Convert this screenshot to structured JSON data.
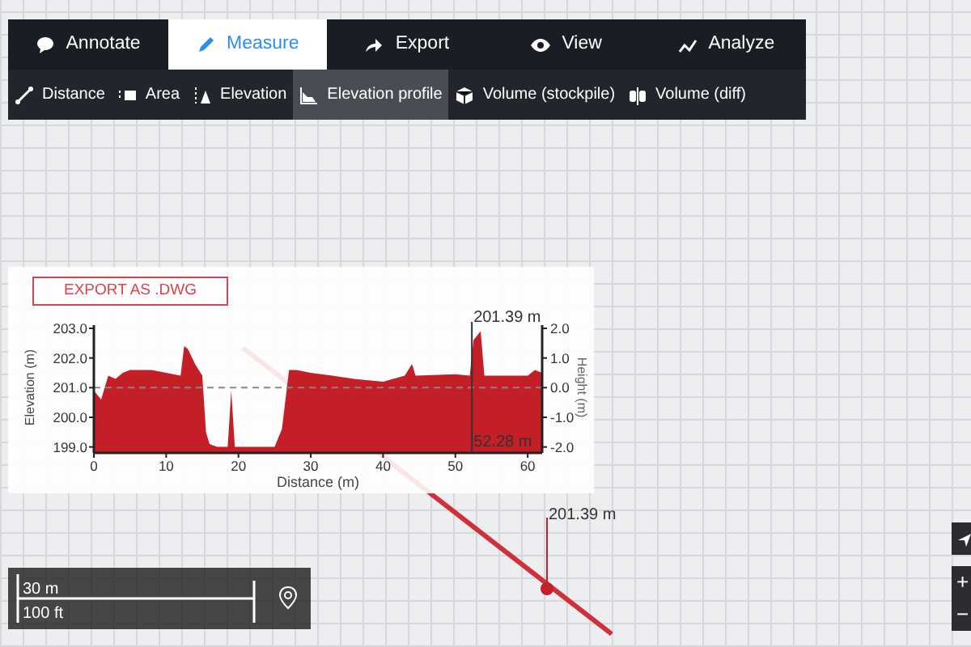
{
  "toolbar": {
    "tabs": [
      {
        "label": "Annotate",
        "selected": false
      },
      {
        "label": "Measure",
        "selected": true
      },
      {
        "label": "Export",
        "selected": false
      },
      {
        "label": "View",
        "selected": false
      },
      {
        "label": "Analyze",
        "selected": false
      }
    ],
    "tools": [
      {
        "label": "Distance",
        "selected": false
      },
      {
        "label": "Area",
        "selected": false
      },
      {
        "label": "Elevation",
        "selected": false
      },
      {
        "label": "Elevation profile",
        "selected": true
      },
      {
        "label": "Volume (stockpile)",
        "selected": false
      },
      {
        "label": "Volume (diff)",
        "selected": false
      }
    ]
  },
  "profile_panel": {
    "export_button": "EXPORT AS .DWG",
    "chart_data": {
      "type": "area",
      "xlabel": "Distance (m)",
      "ylabel": "Elevation (m)",
      "x": [
        0,
        1,
        2,
        3,
        4,
        5,
        8,
        10,
        12,
        12.5,
        13,
        14,
        15,
        15.5,
        16,
        17,
        18.5,
        19,
        19.5,
        25,
        26,
        27,
        28,
        30,
        33,
        36,
        40,
        43,
        44,
        44.5,
        50,
        52,
        52.5,
        53.5,
        54,
        60,
        61,
        62
      ],
      "series": [
        {
          "color": "#c41e26",
          "values": [
            200.9,
            200.6,
            201.4,
            201.3,
            201.5,
            201.6,
            201.6,
            201.5,
            201.4,
            202.4,
            202.3,
            201.8,
            201.4,
            199.5,
            199.1,
            199.0,
            199.0,
            200.9,
            199.0,
            199.0,
            199.6,
            201.6,
            201.6,
            201.5,
            201.4,
            201.3,
            201.2,
            201.4,
            201.8,
            201.4,
            201.45,
            201.4,
            202.6,
            202.9,
            201.4,
            201.4,
            201.6,
            201.5
          ]
        }
      ],
      "xlim": [
        0,
        62
      ],
      "ylim": [
        198.8,
        203.0
      ],
      "xticks": [
        0,
        10,
        20,
        30,
        40,
        50,
        60
      ],
      "yticks": [
        {
          "value": 199,
          "label": "199.0"
        },
        {
          "value": 200,
          "label": "200.0"
        },
        {
          "value": 201,
          "label": "201.0"
        },
        {
          "value": 202,
          "label": "202.0"
        },
        {
          "value": 203,
          "label": "203.0"
        }
      ],
      "ref_lines": [
        {
          "axis": "x",
          "value": 52.28
        }
      ]
    },
    "cursor": {
      "elevation_label": "201.39 m",
      "distance_label": "52.28 m"
    },
    "height_axis": {
      "label": "Height (m)",
      "ticks": [
        "2.0",
        "1.0",
        "0.0",
        "-1.0",
        "-2.0"
      ]
    }
  },
  "map": {
    "marker_label": "201.39 m",
    "scale": {
      "metric": "30 m",
      "imperial": "100 ft"
    },
    "zoom_in": "+",
    "zoom_out": "−"
  }
}
